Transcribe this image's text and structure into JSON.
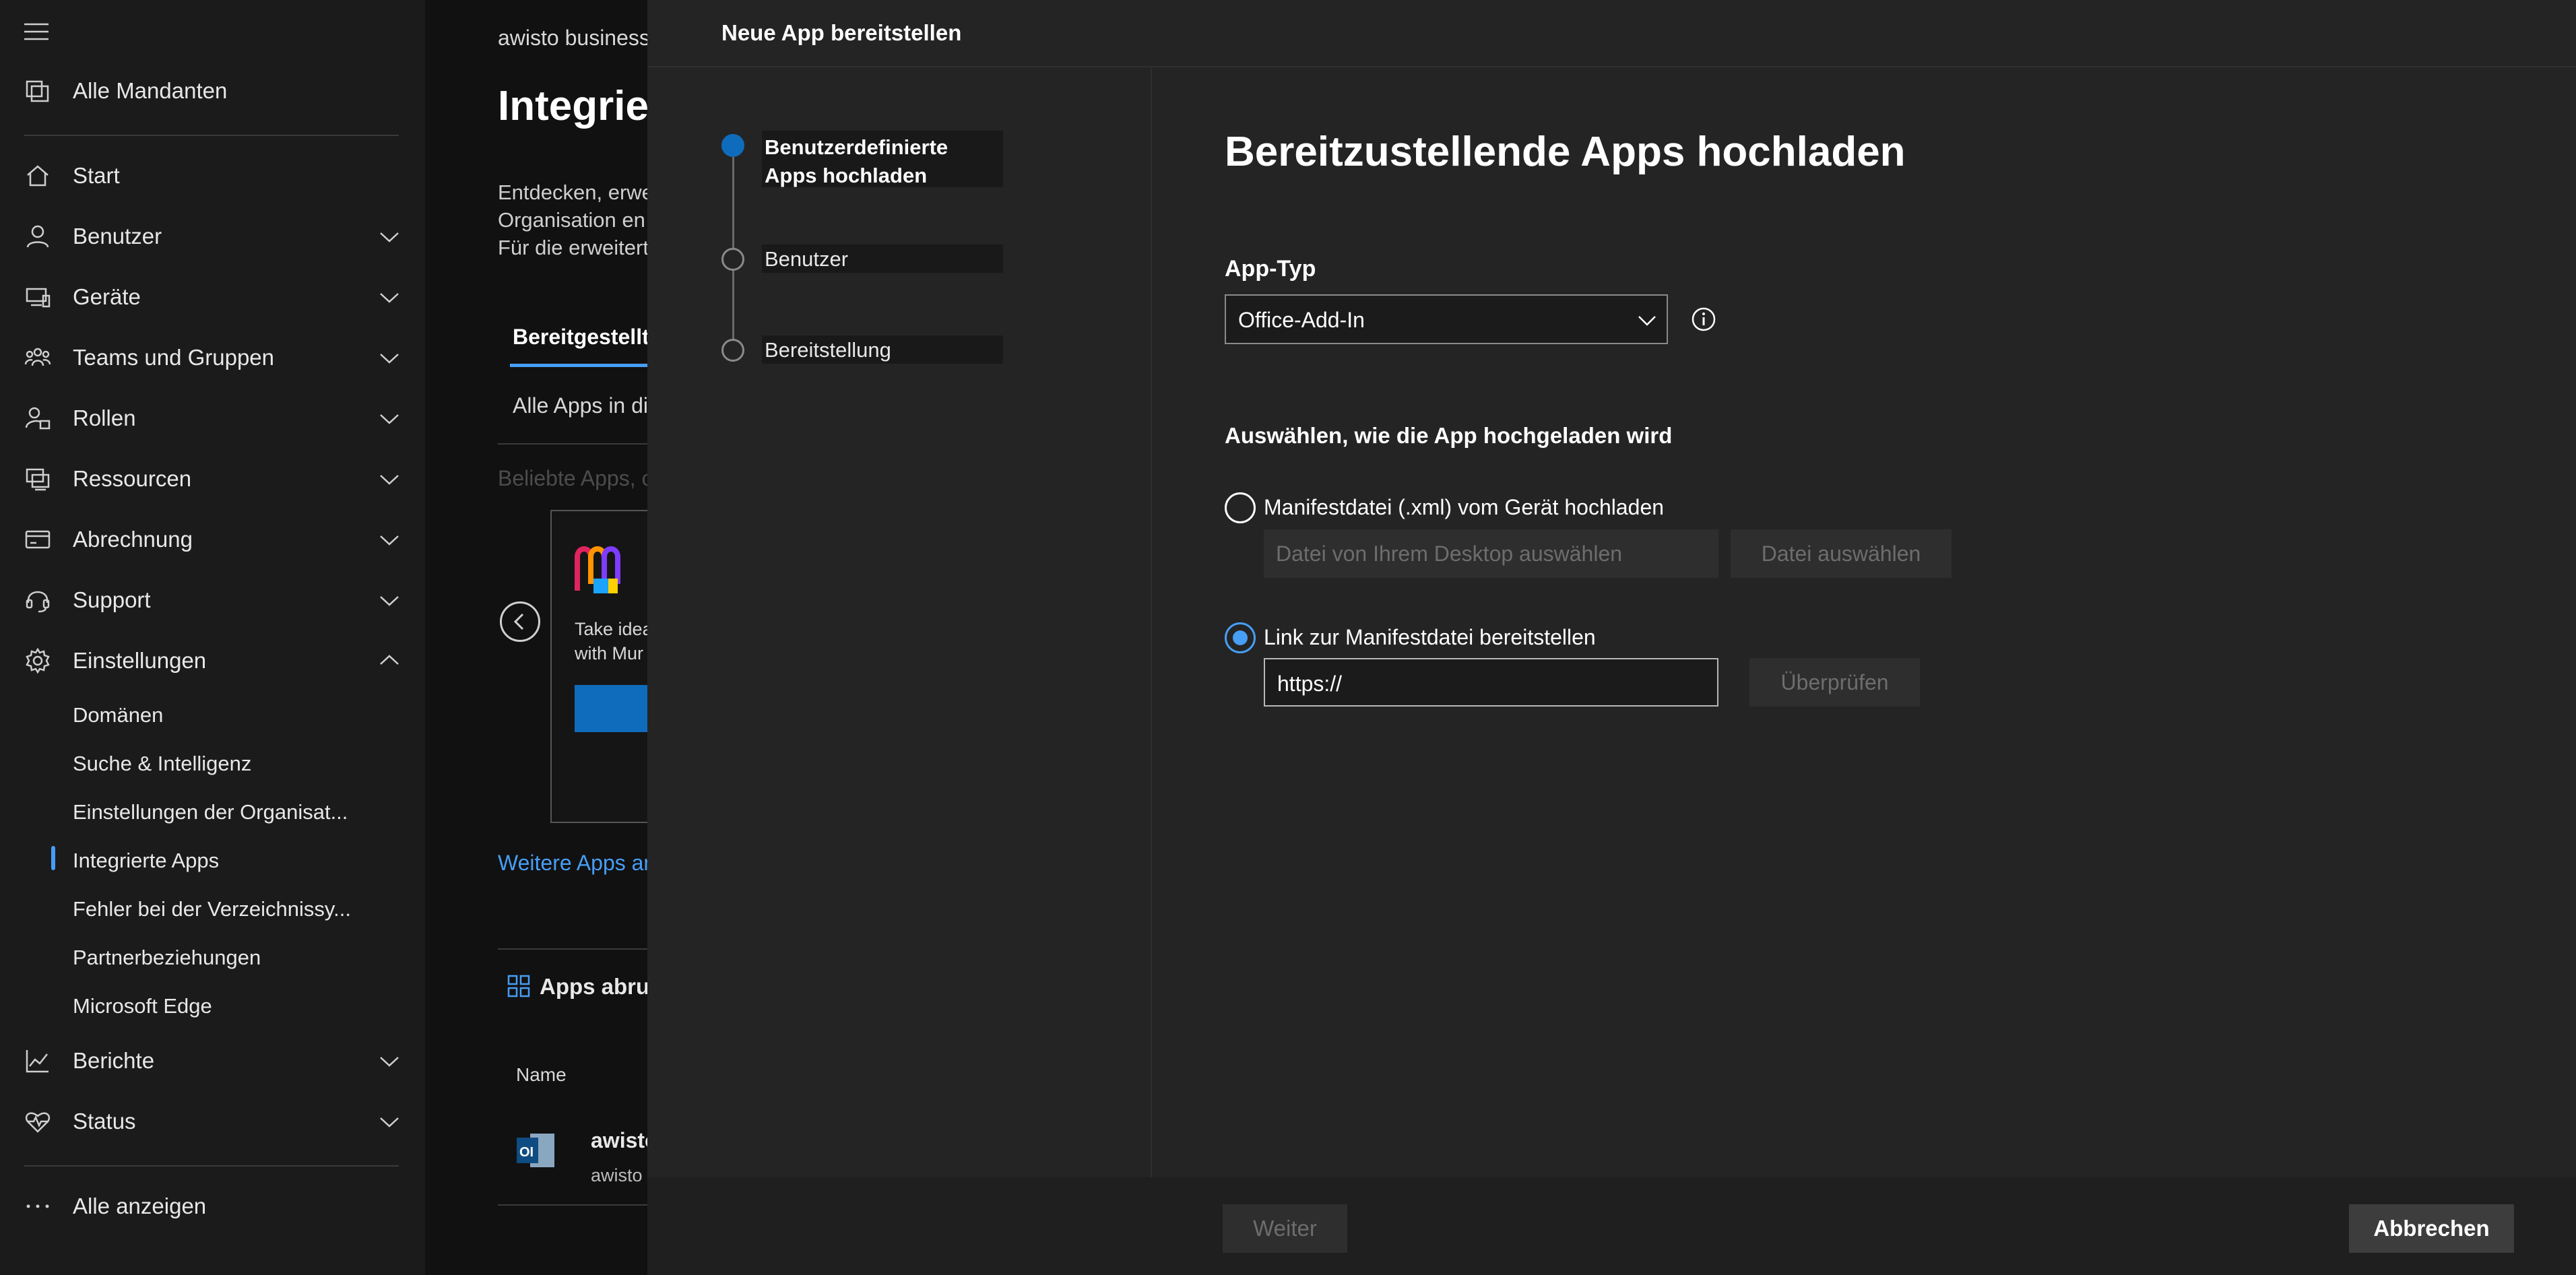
{
  "nav": {
    "items": [
      {
        "label": "Alle Mandanten",
        "icon": "tenants-icon"
      },
      {
        "label": "Start",
        "icon": "home-icon"
      },
      {
        "label": "Benutzer",
        "icon": "person-icon"
      },
      {
        "label": "Geräte",
        "icon": "devices-icon"
      },
      {
        "label": "Teams und Gruppen",
        "icon": "teams-icon"
      },
      {
        "label": "Rollen",
        "icon": "roles-icon"
      },
      {
        "label": "Ressourcen",
        "icon": "resources-icon"
      },
      {
        "label": "Abrechnung",
        "icon": "billing-icon"
      },
      {
        "label": "Support",
        "icon": "headset-icon"
      },
      {
        "label": "Einstellungen",
        "icon": "gear-icon"
      },
      {
        "label": "Berichte",
        "icon": "chart-icon"
      },
      {
        "label": "Status",
        "icon": "heart-pulse-icon"
      },
      {
        "label": "Alle anzeigen",
        "icon": "more-icon"
      }
    ],
    "settings_sub": [
      "Domänen",
      "Suche & Intelligenz",
      "Einstellungen der Organisat...",
      "Integrierte Apps",
      "Fehler bei der Verzeichnissy...",
      "Partnerbeziehungen",
      "Microsoft Edge"
    ],
    "active_sub": "Integrierte Apps"
  },
  "background_page": {
    "tenant": "awisto business",
    "title": "Integrie",
    "desc_lines": [
      "Entdecken, erwe",
      "Organisation en",
      "Für die erweitert"
    ],
    "tab": "Bereitgestellte",
    "subtab": "Alle Apps in di",
    "faded": "Beliebte Apps, c",
    "card_lines": [
      "Take idea",
      "with Mur"
    ],
    "more_link": "Weitere Apps an",
    "apps_label": "Apps abrufe",
    "name_header": "Name",
    "app_title": "awisto",
    "app_sub": "awisto"
  },
  "panel": {
    "header_title": "Neue App bereitstellen",
    "steps": [
      {
        "label": "Benutzerdefinierte Apps hochladen",
        "current": true
      },
      {
        "label": "Benutzer",
        "current": false
      },
      {
        "label": "Bereitstellung",
        "current": false
      }
    ],
    "title": "Bereitzustellende Apps hochladen",
    "app_type_label": "App-Typ",
    "app_type_value": "Office-Add-In",
    "upload_method_label": "Auswählen, wie die App hochgeladen wird",
    "option_file": {
      "label": "Manifestdatei (.xml) vom Gerät hochladen",
      "placeholder": "Datei von Ihrem Desktop auswählen",
      "button": "Datei auswählen",
      "selected": false
    },
    "option_link": {
      "label": "Link zur Manifestdatei bereitstellen",
      "value": "https://",
      "button": "Überprüfen",
      "selected": true
    },
    "footer": {
      "next": "Weiter",
      "cancel": "Abbrechen"
    }
  },
  "colors": {
    "accent": "#479ef5",
    "brand_blue": "#0f6cbd",
    "panel_bg": "#242424",
    "nav_bg": "#1b1b1b"
  }
}
